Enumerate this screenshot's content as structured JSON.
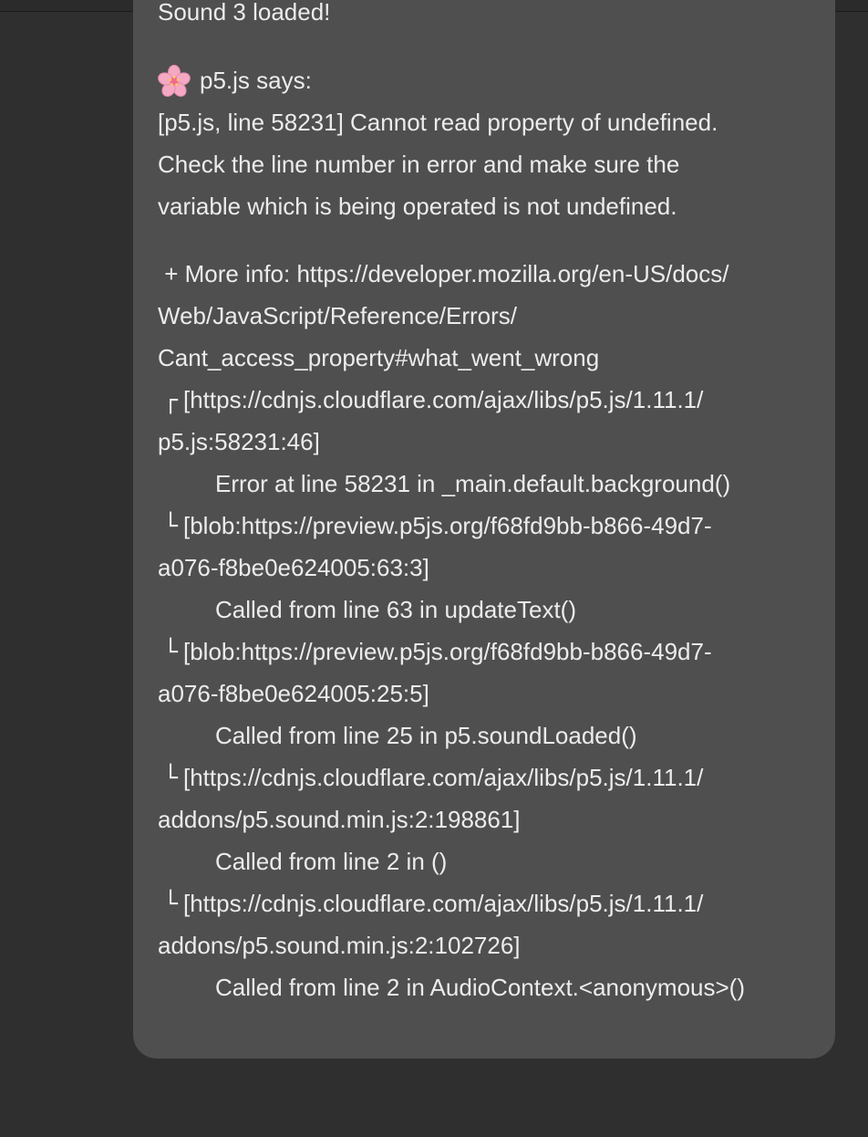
{
  "message": {
    "sound_loaded": "Sound 3 loaded!",
    "says_label": "p5.js says:",
    "error_lines": [
      "[p5.js, line 58231] Cannot read property of undefined.",
      "Check the line number in error and make sure the",
      "variable which is being operated is not undefined."
    ],
    "more_info_lines": [
      " + More info: https://developer.mozilla.org/en-US/docs/",
      "Web/JavaScript/Reference/Errors/",
      "Cant_access_property#what_went_wrong"
    ],
    "stack": [
      {
        "glyph": "┌",
        "location_line1": "[https://cdnjs.cloudflare.com/ajax/libs/p5.js/1.11.1/",
        "location_line2": "p5.js:58231:46]",
        "message": "Error at line 58231 in _main.default.background()"
      },
      {
        "glyph": "└",
        "location_line1": "[blob:https://preview.p5js.org/f68fd9bb-b866-49d7-",
        "location_line2": "a076-f8be0e624005:63:3]",
        "message": "Called from line 63 in updateText()"
      },
      {
        "glyph": "└",
        "location_line1": "[blob:https://preview.p5js.org/f68fd9bb-b866-49d7-",
        "location_line2": "a076-f8be0e624005:25:5]",
        "message": "Called from line 25 in p5.soundLoaded()"
      },
      {
        "glyph": "└",
        "location_line1": "[https://cdnjs.cloudflare.com/ajax/libs/p5.js/1.11.1/",
        "location_line2": "addons/p5.sound.min.js:2:198861]",
        "message": "Called from line 2 in ()"
      },
      {
        "glyph": "└",
        "location_line1": "[https://cdnjs.cloudflare.com/ajax/libs/p5.js/1.11.1/",
        "location_line2": "addons/p5.sound.min.js:2:102726]",
        "message": "Called from line 2 in AudioContext.<anonymous>()"
      }
    ],
    "icon": "cherry-blossom-icon"
  }
}
